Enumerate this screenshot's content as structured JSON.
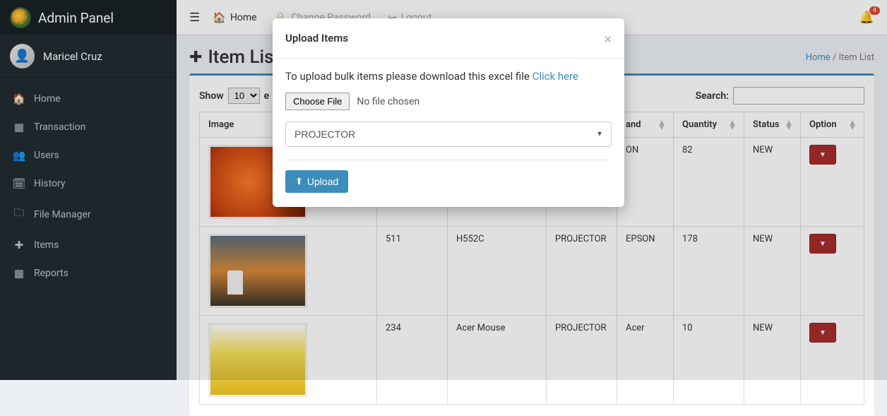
{
  "brand": {
    "title": "Admin Panel"
  },
  "user": {
    "name": "Maricel Cruz"
  },
  "sidebar": {
    "items": [
      {
        "icon": "🏠",
        "label": "Home"
      },
      {
        "icon": "▦",
        "label": "Transaction"
      },
      {
        "icon": "👥",
        "label": "Users"
      },
      {
        "icon": "🗓",
        "label": "History"
      },
      {
        "icon": "🗀",
        "label": "File Manager"
      },
      {
        "icon": "✚",
        "label": "Items"
      },
      {
        "icon": "▦",
        "label": "Reports"
      }
    ]
  },
  "topbar": {
    "links": [
      {
        "icon": "🏠",
        "label": "Home"
      },
      {
        "icon": "🔒",
        "label": "Change Password"
      },
      {
        "icon": "↪",
        "label": "Logout"
      }
    ],
    "notifications": "4"
  },
  "page": {
    "title": "Item List",
    "breadcrumb_home": "Home",
    "breadcrumb_sep": " / ",
    "breadcrumb_current": "Item List"
  },
  "table": {
    "show_prefix": "Show",
    "length": "10",
    "show_suffix": "e",
    "search_label": "Search:",
    "columns": [
      "Image",
      "",
      "",
      "",
      "and",
      "Quantity",
      "Status",
      "Option"
    ],
    "rows": [
      {
        "c1": "",
        "c2": "",
        "c3": "",
        "c4": "ON",
        "c5": "82",
        "c6": "NEW"
      },
      {
        "c1": "511",
        "c2": "H552C",
        "c3": "PROJECTOR",
        "c4": "EPSON",
        "c5": "178",
        "c6": "NEW"
      },
      {
        "c1": "234",
        "c2": "Acer Mouse",
        "c3": "PROJECTOR",
        "c4": "Acer",
        "c5": "10",
        "c6": "NEW"
      }
    ]
  },
  "modal": {
    "title": "Upload Items",
    "prompt": "To upload bulk items please download this excel file ",
    "link": "Click here",
    "choose_label": "Choose File",
    "file_status": "No file chosen",
    "category": "PROJECTOR",
    "upload_label": "Upload"
  }
}
